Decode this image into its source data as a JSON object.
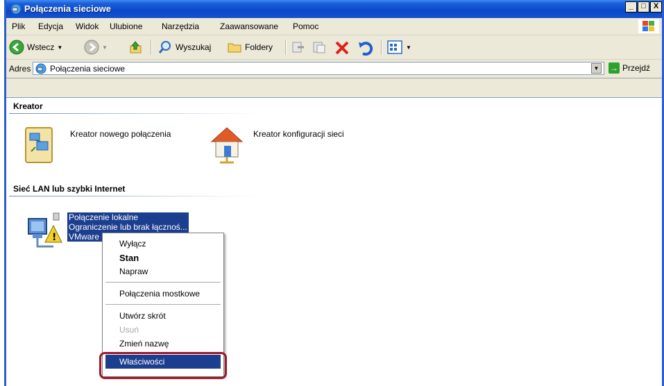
{
  "window": {
    "title": "Połączenia sieciowe",
    "controls": [
      "_",
      "□",
      "X"
    ]
  },
  "menu": [
    "Plik",
    "Edycja",
    "Widok",
    "Ulubione",
    "Narzędzia",
    "Zaawansowane",
    "Pomoc"
  ],
  "toolbar": {
    "back_label": "Wstecz",
    "search_label": "Wyszukaj",
    "folders_label": "Foldery"
  },
  "address": {
    "label": "Adres",
    "value": "Połączenia sieciowe",
    "go_label": "Przejdź"
  },
  "groups": {
    "wizard": {
      "header": "Kreator",
      "items": [
        "Kreator nowego połączenia",
        "Kreator konfiguracji sieci"
      ]
    },
    "lan": {
      "header": "Sieć LAN lub szybki Internet",
      "connection": {
        "name": "Połączenie lokalne",
        "status": "Ograniczenie lub brak łącznoś...",
        "device": "VMware"
      }
    }
  },
  "context_menu": {
    "items": [
      {
        "label": "Wyłącz"
      },
      {
        "label": "Stan",
        "bold": true
      },
      {
        "label": "Napraw"
      },
      {
        "label": "Połączenia mostkowe"
      },
      {
        "label": "Utwórz skrót"
      },
      {
        "label": "Usuń",
        "disabled": true
      },
      {
        "label": "Zmień nazwę"
      },
      {
        "label": "Właściwości",
        "highlighted": true
      }
    ]
  },
  "colors": {
    "titlebar": "#0a48c8",
    "selection": "#1c3e8f",
    "highlight_box": "#a0162a"
  }
}
